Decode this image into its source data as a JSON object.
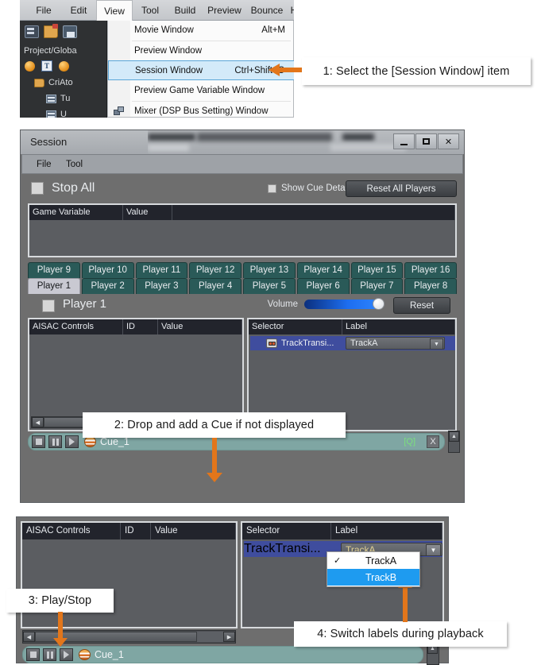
{
  "callouts": [
    {
      "id": "c1",
      "text": "1:  Select the [Session Window] item"
    },
    {
      "id": "c2",
      "text": "2:  Drop and add a Cue if not displayed"
    },
    {
      "id": "c3",
      "text": "3:  Play/Stop"
    },
    {
      "id": "c4",
      "text": "4:  Switch labels during playback"
    }
  ],
  "editor": {
    "menubar": [
      "File",
      "Edit",
      "View",
      "Tool",
      "Build",
      "Preview",
      "Bounce",
      "H"
    ],
    "active_menu": "View",
    "project_label": "Project/Globa",
    "tree": [
      "CriAto",
      "Tu",
      "U"
    ],
    "view_menu": [
      {
        "label": "Movie Window",
        "accel": "Alt+M",
        "selected": false
      },
      {
        "label": "Preview Window",
        "accel": "",
        "selected": false
      },
      {
        "label": "Session Window",
        "accel": "Ctrl+Shift+C",
        "selected": true
      },
      {
        "label": "Preview Game Variable Window",
        "accel": "",
        "selected": false
      },
      {
        "label": "Mixer (DSP Bus Setting) Window",
        "accel": "",
        "selected": false
      }
    ]
  },
  "session": {
    "title": "Session",
    "window_buttons": [
      "minimize",
      "maximize",
      "close"
    ],
    "menubar": [
      "File",
      "Tool"
    ],
    "stop_all_label": "Stop All",
    "show_cue_detail_label": "Show Cue Detail",
    "reset_all_players_label": "Reset All Players",
    "game_variable_table": {
      "columns": [
        "Game Variable",
        "Value"
      ],
      "rows": []
    },
    "player_tabs_row1": [
      "Player 9",
      "Player 10",
      "Player 11",
      "Player 12",
      "Player 13",
      "Player 14",
      "Player 15",
      "Player 16"
    ],
    "player_tabs_row2": [
      "Player 1",
      "Player 2",
      "Player 3",
      "Player 4",
      "Player 5",
      "Player 6",
      "Player 7",
      "Player 8"
    ],
    "active_tab": "Player 1",
    "player_title": "Player 1",
    "volume_label": "Volume",
    "volume_value": "100",
    "reset_label": "Reset",
    "aisac_table": {
      "columns": [
        "AISAC Controls",
        "ID",
        "Value"
      ],
      "rows": []
    },
    "selector_table": {
      "columns": [
        "Selector",
        "Label"
      ],
      "rows": [
        {
          "selector": "TrackTransi...",
          "label": "TrackA"
        }
      ]
    },
    "cue": {
      "name": "Cue_1",
      "quality_tag": "[Q]",
      "close_tag": "X",
      "transport": [
        "stop",
        "pause",
        "play"
      ]
    }
  },
  "bottom_panel": {
    "aisac_table": {
      "columns": [
        "AISAC Controls",
        "ID",
        "Value"
      ],
      "rows": []
    },
    "selector_table": {
      "columns": [
        "Selector",
        "Label"
      ],
      "rows": [
        {
          "selector": "TrackTransi...",
          "label": "TrackA"
        }
      ]
    },
    "dropdown_options": [
      {
        "label": "TrackA",
        "checked": true,
        "highlighted": false
      },
      {
        "label": "TrackB",
        "checked": false,
        "highlighted": true
      }
    ],
    "cue": {
      "name": "Cue_1",
      "transport": [
        "stop",
        "pause",
        "play"
      ]
    }
  },
  "colors": {
    "accent_orange": "#e2761b",
    "tab_teal": "#2a5a58",
    "selection_blue": "#3f4d9e",
    "dropdown_highlight": "#1e9bf0",
    "cue_bar": "#7fa6a3",
    "combo_text": "#e3d394",
    "quality_green": "#7ce07c"
  }
}
